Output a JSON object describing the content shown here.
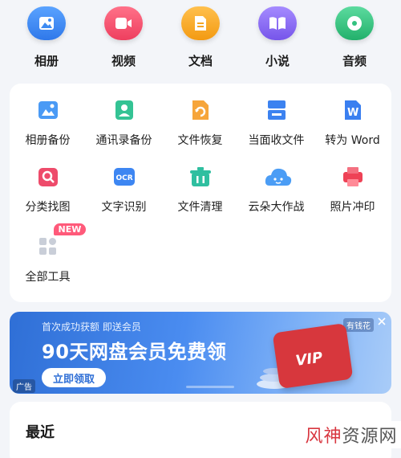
{
  "categories": [
    {
      "label": "相册",
      "icon": "album-icon",
      "color": "#3d8bf2"
    },
    {
      "label": "视频",
      "icon": "video-icon",
      "color": "#f0506e"
    },
    {
      "label": "文档",
      "icon": "document-icon",
      "color": "#f5a623"
    },
    {
      "label": "小说",
      "icon": "novel-icon",
      "color": "#8b6ff0"
    },
    {
      "label": "音频",
      "icon": "audio-icon",
      "color": "#33c17f"
    }
  ],
  "tools": [
    {
      "label": "相册备份",
      "icon": "album-backup-icon"
    },
    {
      "label": "通讯录备份",
      "icon": "contacts-backup-icon"
    },
    {
      "label": "文件恢复",
      "icon": "file-recovery-icon"
    },
    {
      "label": "当面收文件",
      "icon": "receive-file-icon"
    },
    {
      "label": "转为 Word",
      "icon": "word-convert-icon"
    },
    {
      "label": "分类找图",
      "icon": "image-search-icon"
    },
    {
      "label": "文字识别",
      "icon": "ocr-icon",
      "icon_text": "OCR"
    },
    {
      "label": "文件清理",
      "icon": "file-clean-icon"
    },
    {
      "label": "云朵大作战",
      "icon": "cloud-game-icon"
    },
    {
      "label": "照片冲印",
      "icon": "photo-print-icon"
    },
    {
      "label": "全部工具",
      "icon": "all-tools-icon",
      "badge": "NEW"
    }
  ],
  "banner": {
    "subtitle": "首次成功获额 即送会员",
    "title": "90天网盘会员免费领",
    "button": "立即领取",
    "ad_tag": "广告",
    "brand_tag": "有钱花",
    "vip_text": "VIP"
  },
  "recent": {
    "title": "最近"
  },
  "watermark": {
    "part1": "风神",
    "part2": "资源网"
  }
}
